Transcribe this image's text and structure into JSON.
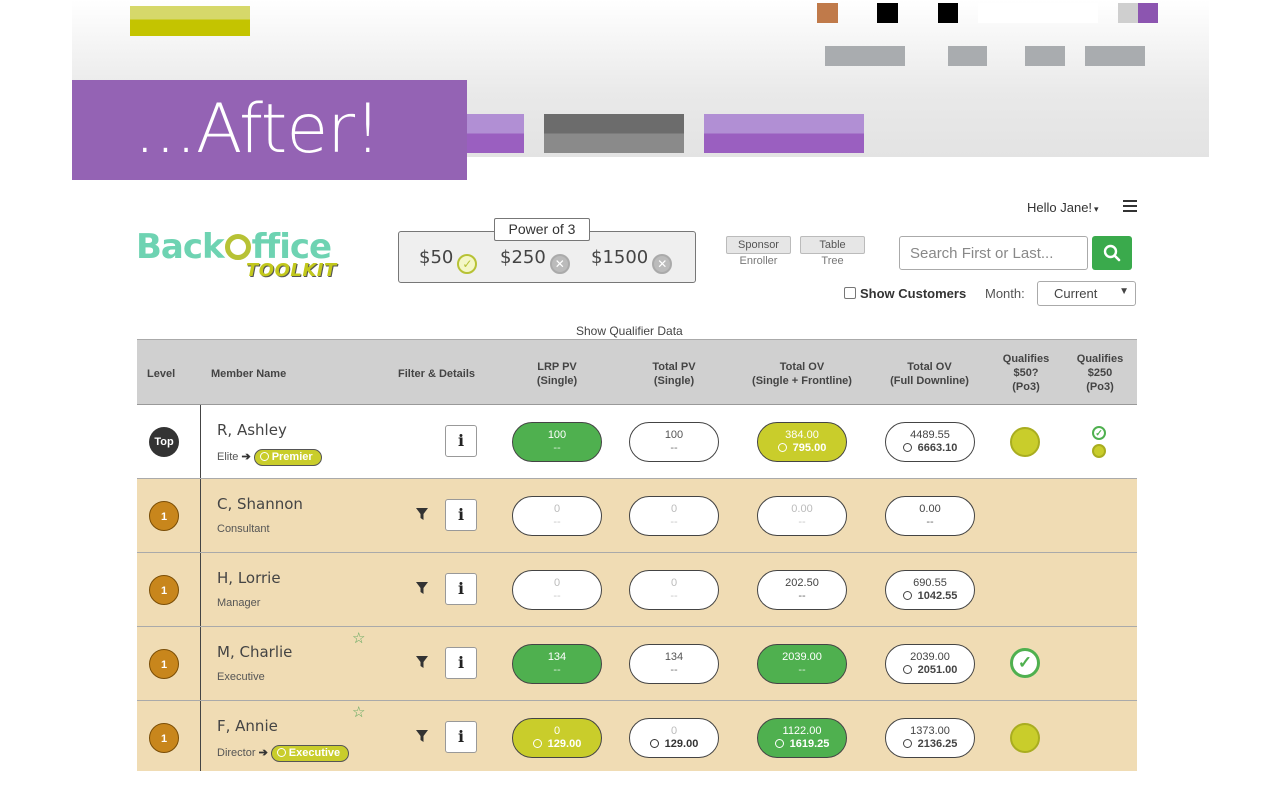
{
  "overlay_label": "...After!",
  "header": {
    "greeting": "Hello Jane!",
    "greeting_caret": "▾"
  },
  "logo": {
    "line1_a": "Back",
    "line1_b": "ffice",
    "line2": "TOOLKIT"
  },
  "power": {
    "title": "Power of 3",
    "tiers": [
      {
        "label": "$50",
        "status": "achieved"
      },
      {
        "label": "$250",
        "status": "not-achieved"
      },
      {
        "label": "$1500",
        "status": "not-achieved"
      }
    ]
  },
  "view_toggles": [
    {
      "label": "Sponsor",
      "sub": "Enroller"
    },
    {
      "label": "Table",
      "sub": "Tree"
    }
  ],
  "search": {
    "placeholder": "Search First or Last..."
  },
  "filters": {
    "show_customers": "Show Customers",
    "month_label": "Month:",
    "month_value": "Current"
  },
  "show_qualifier": "Show Qualifier Data",
  "columns": {
    "level": "Level",
    "member": "Member Name",
    "filter": "Filter & Details",
    "lrp": [
      "LRP PV",
      "(Single)"
    ],
    "tpv": [
      "Total PV",
      "(Single)"
    ],
    "tov1": [
      "Total OV",
      "(Single + Frontline)"
    ],
    "tov2": [
      "Total OV",
      "(Full Downline)"
    ],
    "q50": [
      "Qualifies",
      "$50?",
      "(Po3)"
    ],
    "q250": [
      "Qualifies",
      "$250",
      "(Po3)"
    ]
  },
  "rows": [
    {
      "level": "Top",
      "name": "R, Ashley",
      "rank": "Elite",
      "arrow": "➔",
      "promo": "Premier",
      "lrp": {
        "a": "100",
        "b": "--"
      },
      "tpv": {
        "a": "100",
        "b": "--"
      },
      "tov1": {
        "a": "384.00",
        "b": "795.00"
      },
      "tov2": {
        "a": "4489.55",
        "b": "6663.10"
      }
    },
    {
      "level": "1",
      "name": "C, Shannon",
      "rank": "Consultant",
      "lrp": {
        "a": "0",
        "b": "--"
      },
      "tpv": {
        "a": "0",
        "b": "--"
      },
      "tov1": {
        "a": "0.00",
        "b": "--"
      },
      "tov2": {
        "a": "0.00",
        "b": "--"
      }
    },
    {
      "level": "1",
      "name": "H, Lorrie",
      "rank": "Manager",
      "lrp": {
        "a": "0",
        "b": "--"
      },
      "tpv": {
        "a": "0",
        "b": "--"
      },
      "tov1": {
        "a": "202.50",
        "b": "--"
      },
      "tov2": {
        "a": "690.55",
        "b": "1042.55"
      }
    },
    {
      "level": "1",
      "name": "M, Charlie",
      "rank": "Executive",
      "lrp": {
        "a": "134",
        "b": "--"
      },
      "tpv": {
        "a": "134",
        "b": "--"
      },
      "tov1": {
        "a": "2039.00",
        "b": "--"
      },
      "tov2": {
        "a": "2039.00",
        "b": "2051.00"
      }
    },
    {
      "level": "1",
      "name": "F, Annie",
      "rank": "Director",
      "arrow": "➔",
      "promo": "Executive",
      "lrp": {
        "a": "0",
        "b": "129.00"
      },
      "tpv": {
        "a": "0",
        "b": "129.00"
      },
      "tov1": {
        "a": "1122.00",
        "b": "1619.25"
      },
      "tov2": {
        "a": "1373.00",
        "b": "2136.25"
      }
    }
  ],
  "icons": {
    "search": "search-icon",
    "menu": "hamburger-icon",
    "filter": "funnel-icon",
    "info": "info-icon",
    "star": "star-icon",
    "check": "check-circle-icon",
    "clock": "clock-icon"
  },
  "colors": {
    "accent_purple": "#9463b4",
    "green": "#4fb04f",
    "yellow_green": "#c9cd2b",
    "row_tan": "#f0dcb4",
    "header_gray": "#d0d0d0"
  }
}
